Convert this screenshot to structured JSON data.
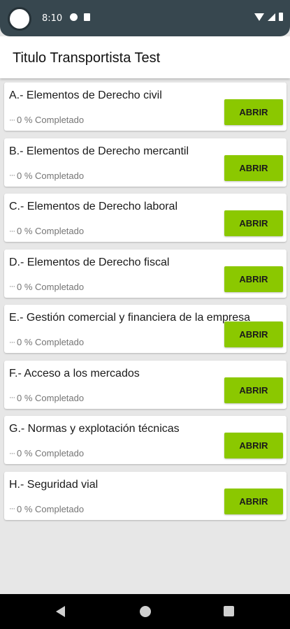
{
  "status_bar": {
    "time": "8:10"
  },
  "app_bar": {
    "title": "Titulo Transportista Test"
  },
  "colors": {
    "status_bar": "#37474f",
    "button": "#8bc800",
    "background": "#e7e7e7"
  },
  "items": [
    {
      "title": "A.- Elementos de Derecho civil",
      "progress": "0 % Completado",
      "button": "ABRIR"
    },
    {
      "title": "B.- Elementos de Derecho mercantil",
      "progress": "0 % Completado",
      "button": "ABRIR"
    },
    {
      "title": "C.- Elementos de Derecho laboral",
      "progress": "0 % Completado",
      "button": "ABRIR"
    },
    {
      "title": "D.- Elementos de Derecho fiscal",
      "progress": "0 % Completado",
      "button": "ABRIR"
    },
    {
      "title": "E.- Gestión comercial y financiera de la empresa",
      "progress": "0 % Completado",
      "button": "ABRIR"
    },
    {
      "title": "F.- Acceso a los mercados",
      "progress": "0 % Completado",
      "button": "ABRIR"
    },
    {
      "title": "G.- Normas y explotación técnicas",
      "progress": "0 % Completado",
      "button": "ABRIR"
    },
    {
      "title": "H.- Seguridad vial",
      "progress": "0 % Completado",
      "button": "ABRIR"
    }
  ]
}
